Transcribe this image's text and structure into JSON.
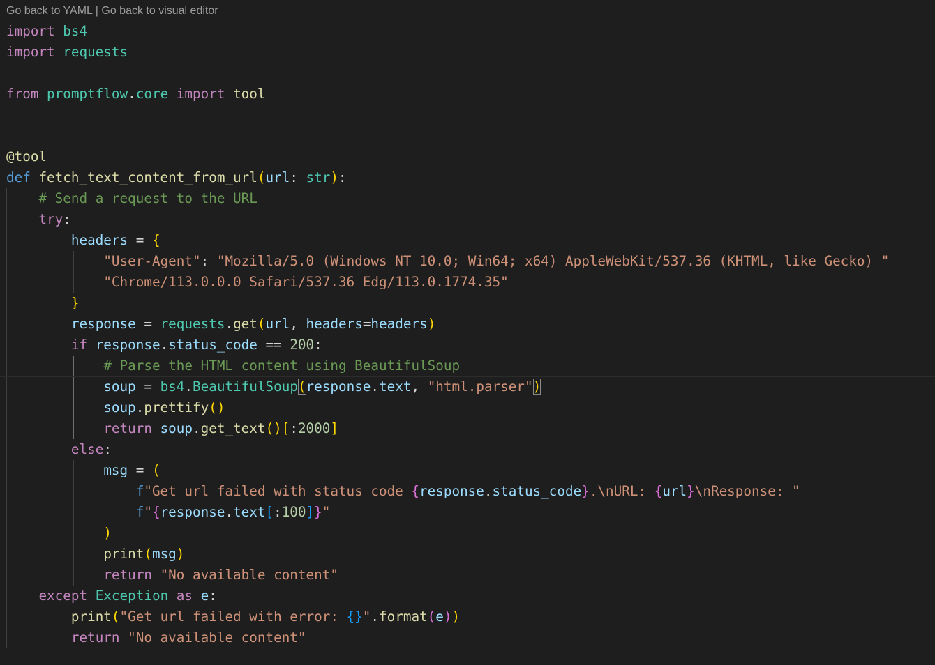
{
  "topbar": {
    "yaml_link": "Go back to YAML",
    "separator": " | ",
    "visual_link": "Go back to visual editor"
  },
  "colors": {
    "background": "#1e1e1e",
    "keyword": "#c586c0",
    "def_keyword": "#569cd6",
    "module": "#4ec9b0",
    "function": "#dcdcaa",
    "variable": "#9cdcfe",
    "string": "#ce9178",
    "number": "#b5cea8",
    "comment": "#6a9955",
    "bracket_level1": "#ffd700",
    "bracket_level2": "#da70d6",
    "bracket_level3": "#179fff"
  },
  "code": {
    "l1": [
      "import",
      " ",
      "bs4"
    ],
    "l2": [
      "import",
      " ",
      "requests"
    ],
    "l4": [
      "from",
      " ",
      "promptflow",
      ".",
      "core",
      " ",
      "import",
      " ",
      "tool"
    ],
    "l7": [
      "@tool"
    ],
    "l8": [
      "def",
      " ",
      "fetch_text_content_from_url",
      "(",
      "url",
      ": ",
      "str",
      ")",
      ":"
    ],
    "l9": [
      "# Send a request to the URL"
    ],
    "l10": [
      "try",
      ":"
    ],
    "l11": [
      "headers",
      " = ",
      "{"
    ],
    "l12": [
      "\"User-Agent\"",
      ": ",
      "\"Mozilla/5.0 (Windows NT 10.0; Win64; x64) AppleWebKit/537.36 (KHTML, like Gecko) \""
    ],
    "l13": [
      "\"Chrome/113.0.0.0 Safari/537.36 Edg/113.0.1774.35\""
    ],
    "l14": [
      "}"
    ],
    "l15": [
      "response",
      " = ",
      "requests",
      ".",
      "get",
      "(",
      "url",
      ", ",
      "headers",
      "=",
      "headers",
      ")"
    ],
    "l16": [
      "if",
      " ",
      "response",
      ".",
      "status_code",
      " == ",
      "200",
      ":"
    ],
    "l17": [
      "# Parse the HTML content using BeautifulSoup"
    ],
    "l18": [
      "soup",
      " = ",
      "bs4",
      ".",
      "BeautifulSoup",
      "(",
      "response",
      ".",
      "text",
      ", ",
      "\"html.parser\"",
      ")"
    ],
    "l19": [
      "soup",
      ".",
      "prettify",
      "()"
    ],
    "l20": [
      "return",
      " ",
      "soup",
      ".",
      "get_text",
      "()",
      "[",
      ":",
      "2000",
      "]"
    ],
    "l21": [
      "else",
      ":"
    ],
    "l22": [
      "msg",
      " = ",
      "("
    ],
    "l23": [
      "f",
      "\"Get url failed with status code ",
      "{",
      "response",
      ".",
      "status_code",
      "}",
      ".\\nURL: ",
      "{",
      "url",
      "}",
      "\\nResponse: \""
    ],
    "l24": [
      "f",
      "\"",
      "{",
      "response",
      ".",
      "text",
      "[",
      ":",
      "100",
      "]",
      "}",
      "\""
    ],
    "l25": [
      ")"
    ],
    "l26": [
      "print",
      "(",
      "msg",
      ")"
    ],
    "l27": [
      "return",
      " ",
      "\"No available content\""
    ],
    "l28": [
      "except",
      " ",
      "Exception",
      " ",
      "as",
      " ",
      "e",
      ":"
    ],
    "l29": [
      "print",
      "(",
      "\"Get url failed with error: ",
      "{}",
      "\"",
      ".",
      "format",
      "(",
      "e",
      ")",
      ")"
    ],
    "l30": [
      "return",
      " ",
      "\"No available content\""
    ]
  }
}
